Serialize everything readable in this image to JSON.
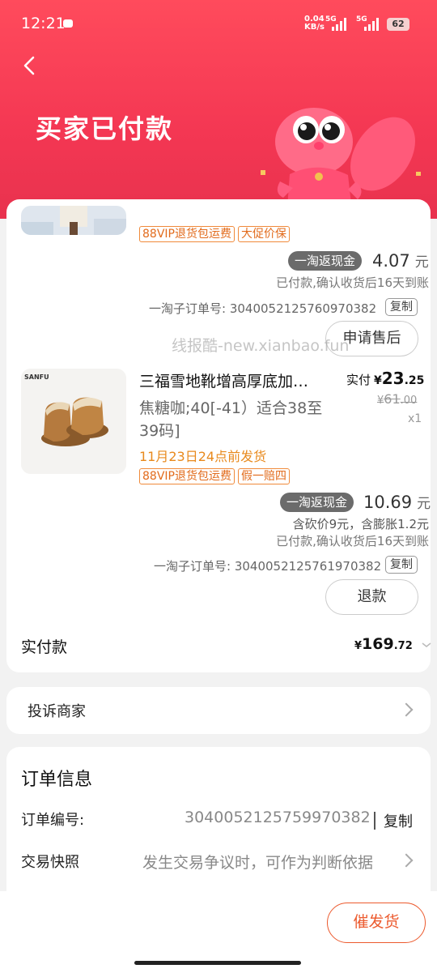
{
  "status_bar": {
    "time": "12:21",
    "net_speed_value": "0.04",
    "net_speed_unit": "KB/s",
    "sim1_label": "5G",
    "sim2_label": "5G",
    "battery": "62"
  },
  "header": {
    "title": "买家已付款",
    "back_icon": "chevron-left-icon",
    "bg_color": "#f43753"
  },
  "items": [
    {
      "tags": [
        "88VIP退货包运费",
        "大促价保"
      ],
      "cashback_badge": "一淘返现金",
      "cashback_amount": "4.07",
      "cashback_unit": "元",
      "cashback_note": "已付款,确认收货后16天到账",
      "suborder_label": "一淘子订单号: 3040052125760970382",
      "copy_label": "复制",
      "action_label": "申请售后"
    },
    {
      "title": "三福雪地靴增高厚底加…",
      "spec": "焦糖咖;40[-41）适合38至39码]",
      "ship_time": "11月23日24点前发货",
      "price_label": "实付",
      "price_currency": "¥",
      "price_int": "23",
      "price_dec": ".25",
      "orig_currency": "¥",
      "orig_price": "61",
      "orig_dec": ".00",
      "qty": "x1",
      "brand": "SANFU",
      "tags": [
        "88VIP退货包运费",
        "假一赔四"
      ],
      "cashback_badge": "一淘返现金",
      "cashback_amount": "10.69",
      "cashback_unit": "元",
      "cashback_detail": "含砍价9元，含膨胀1.2元",
      "cashback_note": "已付款,确认收货后16天到账",
      "suborder_label": "一淘子订单号: 3040052125761970382",
      "copy_label": "复制",
      "action_label": "退款"
    }
  ],
  "total": {
    "label": "实付款",
    "currency": "¥",
    "int": "169",
    "dec": ".72"
  },
  "watermark": "线报酷-new.xianbao.fun",
  "complain": {
    "label": "投诉商家"
  },
  "order_info": {
    "title": "订单信息",
    "order_no_label": "订单编号:",
    "order_no": "3040052125759970382",
    "copy_label": "复制",
    "snapshot_label": "交易快照",
    "snapshot_hint": "发生交易争议时，可作为判断依据"
  },
  "bottom": {
    "urge_label": "催发货",
    "accent_color": "#ec5a2e"
  }
}
